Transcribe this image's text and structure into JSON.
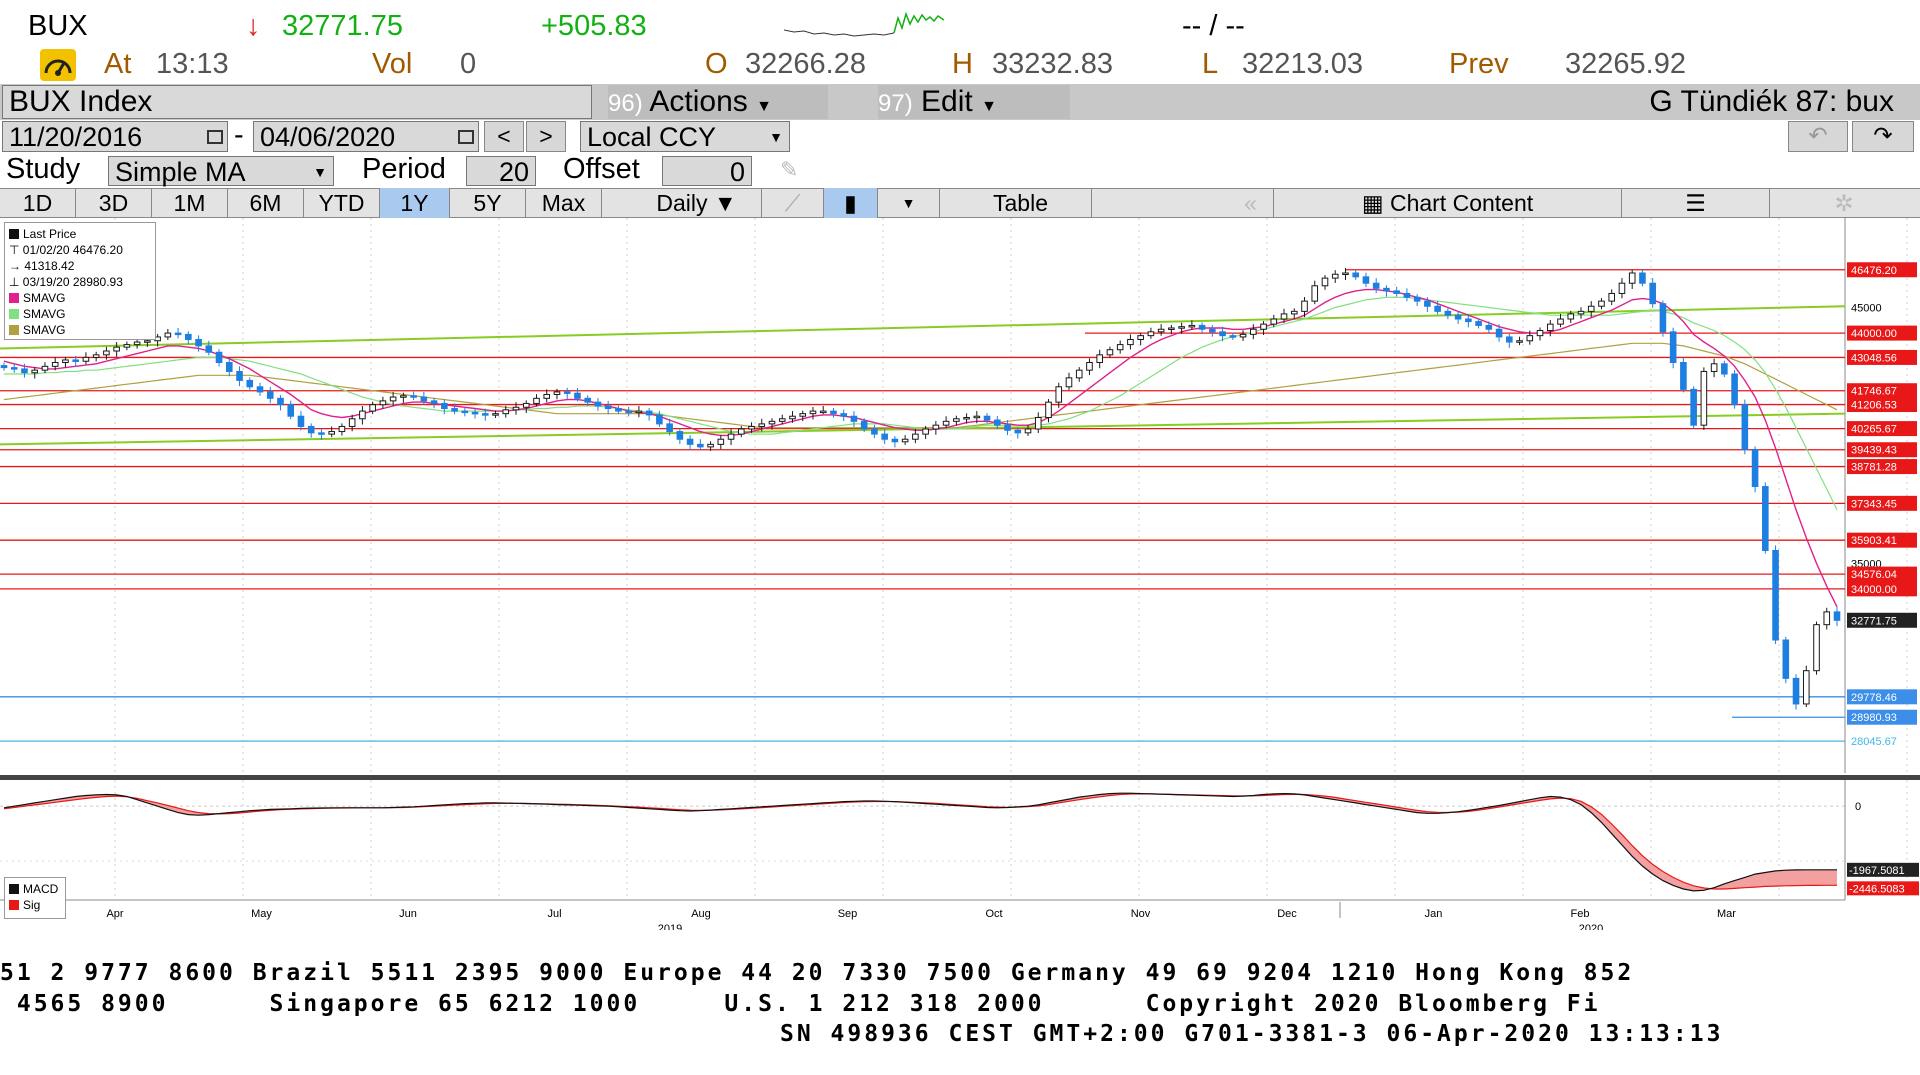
{
  "header": {
    "ticker": "BUX",
    "arrow": "↓",
    "last": "32771.75",
    "change": "+505.83",
    "time_range": "-- / --",
    "at_label": "At",
    "time": "13:13",
    "vol_label": "Vol",
    "vol": "0",
    "open_label": "O",
    "open": "32266.28",
    "high_label": "H",
    "high": "33232.83",
    "low_label": "L",
    "low": "32213.03",
    "prev_label": "Prev",
    "prev": "32265.92"
  },
  "toolbar": {
    "security": "BUX Index",
    "actions_num": "96)",
    "actions": "Actions",
    "edit_num": "97)",
    "edit": "Edit",
    "user": "G Tündiék 87: bux",
    "start_date": "11/20/2016",
    "end_date": "04/06/2020",
    "dash": "-",
    "prev_btn": "<",
    "next_btn": ">",
    "currency": "Local CCY",
    "study_label": "Study",
    "study": "Simple MA",
    "period_label": "Period",
    "period": "20",
    "offset_label": "Offset",
    "offset": "0"
  },
  "tabs": [
    "1D",
    "3D",
    "1M",
    "6M",
    "YTD",
    "1Y",
    "5Y",
    "Max"
  ],
  "active_tab": "1Y",
  "frequency": "Daily",
  "table_label": "Table",
  "chart_content_label": "Chart Content",
  "icons": [
    "dial-icon",
    "calendar-icon",
    "undo-icon",
    "redo-icon",
    "pencil-icon",
    "line-chart-icon",
    "candle-icon",
    "chart-content-icon",
    "settings-icon",
    "gear-icon"
  ],
  "colors": {
    "candle_up": "#1a1a1a",
    "candle_down": "#1e7fe0",
    "sma_pink": "#e0208c",
    "sma_lightgreen": "#80e080",
    "sma_olive": "#b0a040",
    "trend_green": "#88cc22",
    "level_red": "#e81818",
    "level_blue": "#3c8ee8"
  },
  "chart_data": {
    "type": "candlestick",
    "title": "",
    "legend": {
      "last_price": "Last Price",
      "high_line": "01/02/20 46476.20",
      "avg_line": "41318.42",
      "low_line": "03/19/20 28980.93",
      "sma1": "SMAVG",
      "sma2": "SMAVG",
      "sma3": "SMAVG"
    },
    "price_axis": {
      "min": 26800,
      "max": 48500
    },
    "x_ticks": [
      "Apr",
      "May",
      "Jun",
      "Jul",
      "Aug",
      "Sep",
      "Oct",
      "Nov",
      "Dec",
      "Jan",
      "Feb",
      "Mar"
    ],
    "year_labels": [
      "2019",
      "2020"
    ],
    "tick_labels": [
      "45000",
      "35000"
    ],
    "horizontal_levels": [
      46476.2,
      44000.0,
      43048.56,
      41746.67,
      41206.53,
      40265.67,
      39439.43,
      38781.28,
      37343.45,
      35903.41,
      34576.04,
      34000.0,
      29778.46,
      28980.93,
      28045.67
    ],
    "level_labels": [
      "46476.20",
      "44000.00",
      "43048.56",
      "41746.67",
      "41206.53",
      "40265.67",
      "39439.43",
      "38781.28",
      "37343.45",
      "35903.41",
      "34576.04",
      "34000.00",
      "32771.75",
      "29778.46",
      "28980.93",
      "28045.67"
    ],
    "last_value": 32771.75,
    "trendlines": [
      {
        "from": [
          0,
          43400
        ],
        "to": [
          1,
          45050
        ]
      },
      {
        "from": [
          0,
          39650
        ],
        "to": [
          1,
          40850
        ]
      }
    ],
    "closes": [
      42650,
      42600,
      42450,
      42550,
      42700,
      42850,
      42950,
      42900,
      43050,
      43150,
      43300,
      43450,
      43550,
      43650,
      43700,
      43850,
      44000,
      43950,
      43750,
      43500,
      43250,
      42850,
      42500,
      42150,
      41900,
      41700,
      41450,
      41200,
      40750,
      40350,
      40100,
      40050,
      40150,
      40350,
      40650,
      40950,
      41200,
      41350,
      41500,
      41550,
      41500,
      41350,
      41250,
      41050,
      40950,
      40900,
      40850,
      40800,
      40850,
      41000,
      41100,
      41250,
      41450,
      41600,
      41700,
      41650,
      41450,
      41300,
      41150,
      41050,
      40950,
      40900,
      40950,
      40800,
      40450,
      40150,
      39850,
      39650,
      39550,
      39650,
      39850,
      40050,
      40250,
      40350,
      40450,
      40550,
      40650,
      40750,
      40850,
      40950,
      40950,
      40850,
      40750,
      40550,
      40250,
      40050,
      39850,
      39750,
      39850,
      40050,
      40250,
      40400,
      40550,
      40650,
      40700,
      40750,
      40600,
      40400,
      40200,
      40100,
      40250,
      40700,
      41300,
      41900,
      42250,
      42550,
      42850,
      43150,
      43350,
      43550,
      43750,
      43900,
      44050,
      44150,
      44200,
      44250,
      44300,
      44150,
      44050,
      43900,
      43850,
      43950,
      44150,
      44350,
      44550,
      44750,
      44850,
      45250,
      45850,
      46150,
      46300,
      46350,
      46200,
      45950,
      45750,
      45650,
      45550,
      45400,
      45250,
      45050,
      44850,
      44700,
      44550,
      44450,
      44300,
      44150,
      43850,
      43650,
      43700,
      43900,
      44100,
      44350,
      44550,
      44750,
      44850,
      45050,
      45250,
      45550,
      45950,
      46350,
      45950,
      45150,
      44050,
      42850,
      41800,
      40400,
      42500,
      42800,
      42400,
      41200,
      39450,
      38000,
      35500,
      32000,
      30500,
      29500,
      30800,
      32600,
      33100,
      32770
    ],
    "sma_short": [
      42900,
      42800,
      42700,
      42650,
      42600,
      42600,
      42650,
      42700,
      42750,
      42800,
      42900,
      43000,
      43100,
      43200,
      43300,
      43400,
      43500,
      43500,
      43450,
      43400,
      43300,
      43150,
      43000,
      42800,
      42600,
      42350,
      42100,
      41850,
      41600,
      41300,
      41000,
      40850,
      40750,
      40700,
      40750,
      40850,
      40950,
      41050,
      41150,
      41250,
      41300,
      41300,
      41250,
      41200,
      41150,
      41100,
      41050,
      41000,
      40950,
      40950,
      41000,
      41050,
      41150,
      41250,
      41350,
      41400,
      41400,
      41350,
      41250,
      41150,
      41050,
      40950,
      40900,
      40850,
      40750,
      40600,
      40450,
      40300,
      40150,
      40050,
      40000,
      40000,
      40050,
      40150,
      40250,
      40350,
      40450,
      40550,
      40650,
      40750,
      40800,
      40800,
      40750,
      40700,
      40600,
      40500,
      40400,
      40300,
      40250,
      40200,
      40200,
      40250,
      40300,
      40400,
      40500,
      40550,
      40550,
      40500,
      40450,
      40400,
      40400,
      40500,
      40700,
      40950,
      41250,
      41550,
      41850,
      42150,
      42450,
      42750,
      43050,
      43300,
      43550,
      43750,
      43900,
      44050,
      44150,
      44200,
      44200,
      44200,
      44150,
      44150,
      44200,
      44250,
      44350,
      44450,
      44550,
      44700,
      44950,
      45200,
      45400,
      45550,
      45650,
      45700,
      45700,
      45650,
      45600,
      45500,
      45400,
      45300,
      45150,
      45000,
      44850,
      44700,
      44550,
      44400,
      44250,
      44150,
      44050,
      44000,
      44000,
      44050,
      44150,
      44300,
      44450,
      44600,
      44750,
      44900,
      45100,
      45300,
      45350,
      45300,
      45150,
      44850,
      44450,
      43950,
      43650,
      43400,
      43100,
      42700,
      42150,
      41500,
      40600,
      39500,
      38300,
      37100,
      36000,
      35000,
      34100,
      33300
    ],
    "sma_mid": [
      42400,
      42400,
      42400,
      42400,
      42450,
      42450,
      42500,
      42500,
      42550,
      42550,
      42600,
      42650,
      42700,
      42750,
      42800,
      42850,
      42900,
      42950,
      43000,
      43050,
      43050,
      43050,
      43000,
      42950,
      42900,
      42800,
      42700,
      42600,
      42500,
      42400,
      42250,
      42100,
      41950,
      41800,
      41650,
      41500,
      41400,
      41300,
      41200,
      41150,
      41100,
      41050,
      41000,
      40950,
      40950,
      40950,
      40950,
      40950,
      40950,
      40950,
      41000,
      41000,
      41050,
      41050,
      41100,
      41100,
      41150,
      41150,
      41150,
      41100,
      41050,
      41000,
      40950,
      40900,
      40850,
      40750,
      40650,
      40550,
      40450,
      40350,
      40250,
      40150,
      40100,
      40050,
      40050,
      40050,
      40100,
      40150,
      40200,
      40250,
      40300,
      40350,
      40400,
      40450,
      40450,
      40450,
      40450,
      40400,
      40350,
      40300,
      40250,
      40250,
      40250,
      40250,
      40300,
      40350,
      40400,
      40400,
      40400,
      40400,
      40400,
      40400,
      40450,
      40550,
      40650,
      40800,
      40950,
      41150,
      41350,
      41550,
      41800,
      42050,
      42300,
      42550,
      42800,
      43050,
      43250,
      43450,
      43600,
      43750,
      43850,
      43950,
      44050,
      44150,
      44250,
      44350,
      44450,
      44550,
      44700,
      44850,
      45000,
      45100,
      45200,
      45300,
      45350,
      45400,
      45400,
      45400,
      45350,
      45300,
      45250,
      45200,
      45150,
      45100,
      45050,
      45000,
      44950,
      44900,
      44850,
      44800,
      44750,
      44700,
      44700,
      44700,
      44700,
      44700,
      44700,
      44700,
      44750,
      44800,
      44850,
      44900,
      44850,
      44750,
      44600,
      44400,
      44250,
      44100,
      43900,
      43650,
      43350,
      42950,
      42450,
      41800,
      41100,
      40300,
      39500,
      38700,
      37900,
      37100
    ],
    "sma_long": [
      41400,
      41450,
      41500,
      41550,
      41600,
      41650,
      41700,
      41750,
      41800,
      41850,
      41900,
      41950,
      42000,
      42050,
      42100,
      42150,
      42200,
      42250,
      42300,
      42350,
      42350,
      42350,
      42350,
      42350,
      42350,
      42300,
      42250,
      42200,
      42150,
      42100,
      42050,
      42000,
      41950,
      41900,
      41850,
      41800,
      41750,
      41700,
      41650,
      41600,
      41550,
      41500,
      41450,
      41400,
      41350,
      41300,
      41250,
      41200,
      41150,
      41100,
      41050,
      41000,
      40950,
      40900,
      40850,
      40850,
      40850,
      40850,
      40850,
      40850,
      40850,
      40850,
      40850,
      40850,
      40800,
      40750,
      40700,
      40650,
      40600,
      40550,
      40500,
      40450,
      40400,
      40350,
      40300,
      40300,
      40300,
      40300,
      40300,
      40300,
      40300,
      40300,
      40300,
      40300,
      40300,
      40300,
      40300,
      40300,
      40300,
      40300,
      40300,
      40300,
      40300,
      40300,
      40350,
      40400,
      40450,
      40500,
      40550,
      40600,
      40650,
      40700,
      40750,
      40800,
      40850,
      40900,
      40950,
      41000,
      41050,
      41100,
      41150,
      41200,
      41250,
      41300,
      41350,
      41400,
      41450,
      41500,
      41550,
      41600,
      41650,
      41700,
      41750,
      41800,
      41850,
      41900,
      41950,
      42000,
      42050,
      42100,
      42150,
      42200,
      42250,
      42300,
      42350,
      42400,
      42450,
      42500,
      42550,
      42600,
      42650,
      42700,
      42750,
      42800,
      42850,
      42900,
      42950,
      43000,
      43050,
      43100,
      43150,
      43200,
      43250,
      43300,
      43350,
      43400,
      43450,
      43500,
      43550,
      43600,
      43600,
      43600,
      43600,
      43550,
      43500,
      43400,
      43300,
      43200,
      43100,
      42950,
      42800,
      42600,
      42400,
      42200,
      42000,
      41800,
      41600,
      41400,
      41200,
      41000
    ],
    "macd": {
      "legend": [
        "MACD",
        "Sig"
      ],
      "axis_labels": [
        "0",
        "-1967.5081",
        "-2446.5083"
      ],
      "range": [
        -2900,
        500
      ],
      "macd_line": [
        -50,
        0,
        50,
        100,
        150,
        200,
        250,
        300,
        330,
        350,
        360,
        350,
        300,
        200,
        100,
        0,
        -100,
        -200,
        -260,
        -280,
        -260,
        -230,
        -200,
        -170,
        -140,
        -120,
        -100,
        -90,
        -80,
        -70,
        -60,
        -55,
        -50,
        -50,
        -50,
        -50,
        -50,
        -50,
        -40,
        -30,
        -20,
        0,
        20,
        40,
        60,
        80,
        90,
        100,
        100,
        95,
        90,
        80,
        70,
        60,
        50,
        40,
        30,
        20,
        10,
        0,
        -20,
        -40,
        -60,
        -80,
        -100,
        -120,
        -140,
        -150,
        -140,
        -120,
        -100,
        -80,
        -60,
        -40,
        -20,
        0,
        20,
        40,
        60,
        80,
        100,
        120,
        140,
        150,
        160,
        160,
        150,
        140,
        120,
        100,
        80,
        60,
        40,
        20,
        0,
        -20,
        -40,
        -50,
        -40,
        -20,
        0,
        40,
        100,
        160,
        220,
        280,
        320,
        360,
        390,
        400,
        400,
        390,
        380,
        370,
        360,
        350,
        340,
        330,
        320,
        310,
        300,
        310,
        330,
        360,
        380,
        390,
        380,
        350,
        300,
        250,
        200,
        150,
        100,
        50,
        0,
        -50,
        -100,
        -150,
        -200,
        -220,
        -220,
        -200,
        -170,
        -130,
        -80,
        -30,
        20,
        80,
        140,
        200,
        260,
        300,
        280,
        200,
        50,
        -200,
        -500,
        -850,
        -1200,
        -1550,
        -1850,
        -2100,
        -2300,
        -2450,
        -2560,
        -2620,
        -2600,
        -2520,
        -2400,
        -2300,
        -2200,
        -2100,
        -2050,
        -2000,
        -1980,
        -1970,
        -1968,
        -1967,
        -1967,
        -1967
      ],
      "signal_line": [
        -80,
        -40,
        0,
        40,
        80,
        120,
        160,
        200,
        240,
        270,
        300,
        310,
        290,
        240,
        170,
        100,
        20,
        -60,
        -140,
        -200,
        -230,
        -240,
        -230,
        -210,
        -180,
        -150,
        -130,
        -110,
        -95,
        -85,
        -75,
        -65,
        -60,
        -55,
        -52,
        -50,
        -50,
        -50,
        -45,
        -40,
        -30,
        -15,
        0,
        15,
        30,
        45,
        60,
        75,
        85,
        90,
        90,
        85,
        78,
        70,
        62,
        55,
        45,
        35,
        25,
        15,
        0,
        -15,
        -30,
        -50,
        -70,
        -90,
        -110,
        -125,
        -130,
        -125,
        -115,
        -100,
        -85,
        -65,
        -45,
        -25,
        -5,
        15,
        35,
        55,
        75,
        95,
        115,
        130,
        140,
        145,
        145,
        140,
        130,
        115,
        100,
        85,
        65,
        45,
        25,
        5,
        -15,
        -30,
        -35,
        -30,
        -15,
        10,
        50,
        100,
        150,
        200,
        250,
        290,
        330,
        360,
        375,
        380,
        378,
        372,
        365,
        358,
        350,
        342,
        334,
        326,
        318,
        316,
        320,
        330,
        345,
        360,
        365,
        360,
        340,
        310,
        270,
        220,
        170,
        120,
        70,
        20,
        -30,
        -80,
        -130,
        -170,
        -190,
        -195,
        -185,
        -160,
        -120,
        -75,
        -25,
        25,
        80,
        130,
        180,
        225,
        250,
        230,
        150,
        -20,
        -250,
        -550,
        -880,
        -1220,
        -1530,
        -1800,
        -2020,
        -2200,
        -2350,
        -2460,
        -2530,
        -2560,
        -2560,
        -2540,
        -2520,
        -2500,
        -2480,
        -2470,
        -2460,
        -2455,
        -2450,
        -2448,
        -2447,
        -2447
      ]
    }
  },
  "footer": {
    "line1": "51 2 9777 8600 Brazil 5511 2395 9000 Europe 44 20 7330 7500 Germany 49 69 9204 1210 Hong Kong 852",
    "line2": " 4565 8900      Singapore 65 6212 1000     U.S. 1 212 318 2000      Copyright 2020 Bloomberg Fi",
    "line3": "SN 498936 CEST GMT+2:00 G701-3381-3 06-Apr-2020 13:13:13"
  }
}
